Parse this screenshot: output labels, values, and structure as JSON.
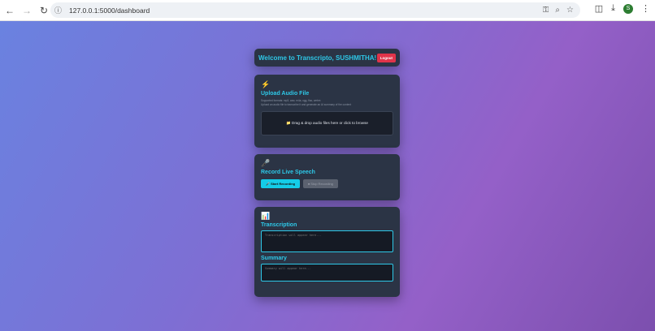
{
  "browser": {
    "url": "127.0.0.1:5000/dashboard",
    "profile_initial": "S"
  },
  "header": {
    "title": "Welcome to Transcripto, SUSHMITHA!",
    "logout_label": "Logout"
  },
  "upload": {
    "icon": "⚡",
    "title": "Upload Audio File",
    "hint_line1": "Supported formats: mp3, wav, m4a, ogg, flac, webm",
    "hint_line2": "Upload an audio file to transcribe it and generate an AI summary of the content",
    "dropzone_label": "📁 Drag & drop audio files here or click to browse"
  },
  "record": {
    "icon": "🎤",
    "title": "Record Live Speech",
    "start_label": "🎤 Start Recording",
    "stop_label": "⏹ Stop Recording"
  },
  "transcription": {
    "icon": "📊",
    "title": "Transcription",
    "placeholder": "Transcription will appear here...",
    "summary_title": "Summary",
    "summary_placeholder": "Summary will appear here..."
  }
}
